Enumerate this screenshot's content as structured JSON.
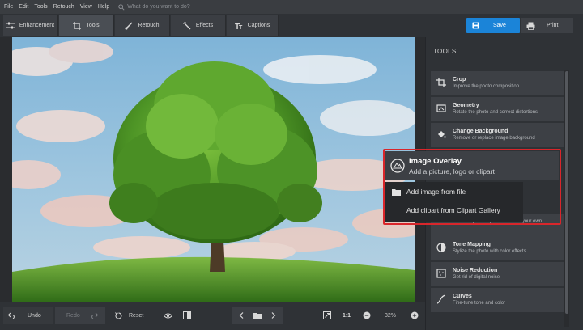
{
  "menu": {
    "items": [
      "File",
      "Edit",
      "Tools",
      "Retouch",
      "View",
      "Help"
    ],
    "search_placeholder": "What do you want to do?"
  },
  "toolbar": {
    "tabs": [
      {
        "label": "Enhancement",
        "icon": "sliders-icon"
      },
      {
        "label": "Tools",
        "icon": "crop-icon",
        "active": true
      },
      {
        "label": "Retouch",
        "icon": "brush-icon"
      },
      {
        "label": "Effects",
        "icon": "magic-wand-icon"
      },
      {
        "label": "Captions",
        "icon": "text-icon"
      }
    ],
    "save_label": "Save",
    "print_label": "Print"
  },
  "panel": {
    "title": "TOOLS",
    "tools": [
      {
        "title": "Crop",
        "desc": "Improve the photo composition",
        "icon": "crop-icon"
      },
      {
        "title": "Geometry",
        "desc": "Rotate the photo and correct distortions",
        "icon": "geometry-icon"
      },
      {
        "title": "Change Background",
        "desc": "Remove or replace image background",
        "icon": "paint-bucket-icon"
      },
      {
        "title": "",
        "desc": "Use ready-made profiles or add your own",
        "icon": ""
      },
      {
        "title": "Tone Mapping",
        "desc": "Stylize the photo with color effects",
        "icon": "tone-icon"
      },
      {
        "title": "Noise Reduction",
        "desc": "Get rid of digital noise",
        "icon": "noise-icon"
      },
      {
        "title": "Curves",
        "desc": "Fine-tune tone and color",
        "icon": "curves-icon"
      }
    ]
  },
  "overlay": {
    "title": "Image Overlay",
    "desc": "Add a picture, logo or clipart",
    "menu": [
      "Add image from file",
      "Add clipart from Clipart Gallery"
    ],
    "highlight_color": "#d9262b"
  },
  "bottom": {
    "undo_label": "Undo",
    "redo_label": "Redo",
    "reset_label": "Reset",
    "zoom_ratio": "1:1",
    "zoom_percent": "32%"
  },
  "colors": {
    "accent": "#1b84d8",
    "panel": "#3d4045",
    "background": "#2f3236"
  }
}
